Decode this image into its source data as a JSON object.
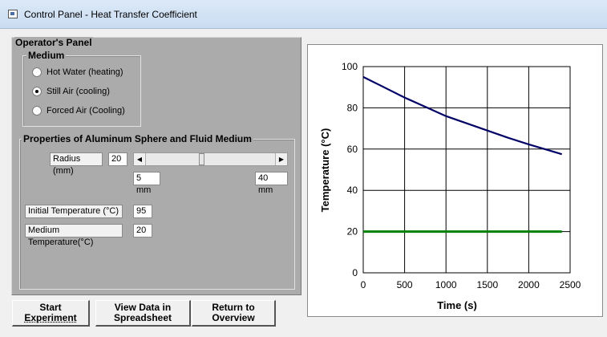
{
  "window": {
    "title": "Control Panel - Heat Transfer Coefficient"
  },
  "operator_panel": {
    "title": "Operator's Panel",
    "medium": {
      "title": "Medium",
      "options": [
        {
          "label": "Hot Water (heating)",
          "selected": false
        },
        {
          "label": "Still Air (cooling)",
          "selected": true
        },
        {
          "label": "Forced Air (Cooling)",
          "selected": false
        }
      ]
    },
    "properties": {
      "title": "Properties of Aluminum Sphere and Fluid Medium",
      "radius_label": "Radius (mm)",
      "radius_value": "20",
      "radius_min_label": "5 mm",
      "radius_max_label": "40 mm",
      "radius_slider_fraction": 0.43,
      "initial_temp_label": "Initial Temperature (°C)",
      "initial_temp_value": "95",
      "medium_temp_label": "Medium Temperature(°C)",
      "medium_temp_value": "20"
    }
  },
  "buttons": {
    "start": [
      "Start",
      "Experiment"
    ],
    "view_data": [
      "View Data in",
      "Spreadsheet"
    ],
    "return": [
      "Return to",
      "Overview"
    ]
  },
  "chart_data": {
    "type": "line",
    "xlabel": "Time (s)",
    "ylabel": "Temperature (°C)",
    "xlim": [
      0,
      2500
    ],
    "ylim": [
      0,
      100
    ],
    "xticks": [
      0,
      500,
      1000,
      1500,
      2000,
      2500
    ],
    "yticks": [
      0,
      20,
      40,
      60,
      80,
      100
    ],
    "grid": true,
    "series": [
      {
        "color": "#000066",
        "x": [
          0,
          250,
          500,
          750,
          1000,
          1250,
          1500,
          1750,
          2000,
          2250,
          2400
        ],
        "y": [
          95,
          90,
          85,
          80.5,
          76,
          72.5,
          69,
          65.5,
          62.3,
          59.3,
          57.5
        ]
      },
      {
        "color": "#008000",
        "x": [
          0,
          2400
        ],
        "y": [
          20,
          20
        ]
      }
    ]
  }
}
